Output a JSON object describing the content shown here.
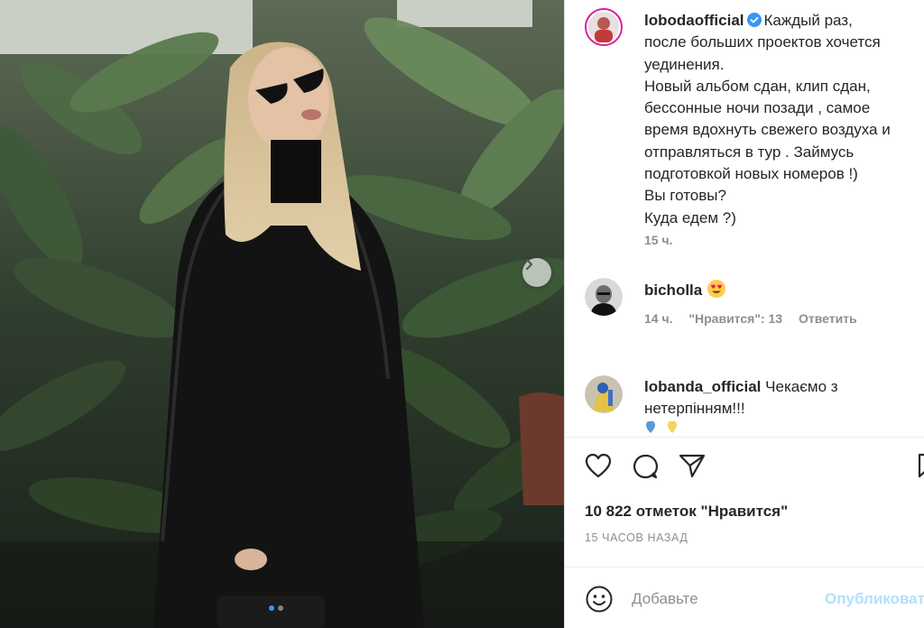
{
  "photo": {
    "next_icon": "chevron-right-icon",
    "carousel": {
      "count": 2,
      "active": 0
    }
  },
  "caption": {
    "username": "lobodaofficial",
    "verified_icon": "verified-badge-icon",
    "lines": [
      "Каждый раз,",
      "после больших проектов хочется",
      "уединения.",
      "Новый альбом сдан, клип сдан,",
      "бессонные ночи позади , самое",
      "время вдохнуть свежего воздуха и",
      "отправляться в тур . Займусь",
      "подготовкой новых номеров !)",
      "Вы готовы?",
      "Куда едем ?)"
    ],
    "time": "15 ч."
  },
  "comments": [
    {
      "username": "bicholla",
      "text": "",
      "emoji": "heart-eyes-emoji",
      "time": "14 ч.",
      "likes": "\"Нравится\": 13",
      "reply": "Ответить"
    },
    {
      "username": "lobanda_official",
      "text": "Чекаємо з",
      "text2": "нетерпінням!!!",
      "emoji": "blue-yellow-hearts-emoji"
    }
  ],
  "actions": {
    "like_icon": "heart-icon",
    "comment_icon": "comment-icon",
    "share_icon": "share-icon",
    "save_icon": "bookmark-icon"
  },
  "likes_text": "10 822 отметок \"Нравится\"",
  "time_ago": "15 ЧАСОВ НАЗАД",
  "add_comment": {
    "emoji_icon": "smile-icon",
    "placeholder": "Добавьте",
    "publish": "Опубликовать"
  },
  "colors": {
    "link_blue": "#0095f6",
    "publish_disabled": "#b2dffc",
    "muted": "#8e8e8e",
    "text": "#262626"
  }
}
